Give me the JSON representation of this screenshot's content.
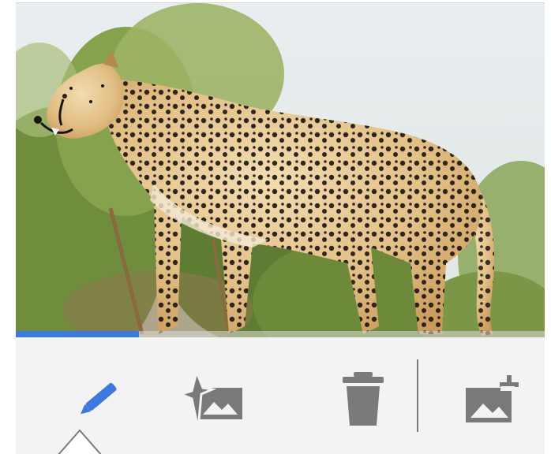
{
  "photo": {
    "subject": "cheetah-photo"
  },
  "progress": {
    "fraction": 0.233,
    "color": "#3d7ae0"
  },
  "toolbar": {
    "tools": [
      {
        "name": "edit-tool",
        "icon": "pencil-icon",
        "color": "#3d7ae0",
        "selected": true
      },
      {
        "name": "enhance-tool",
        "icon": "magic-image-icon",
        "color": "#7a7a7a",
        "selected": false
      },
      {
        "name": "delete-tool",
        "icon": "trash-icon",
        "color": "#7a7a7a",
        "selected": false
      },
      {
        "name": "add-image-tool",
        "icon": "add-image-icon",
        "color": "#7a7a7a",
        "selected": false
      }
    ]
  }
}
